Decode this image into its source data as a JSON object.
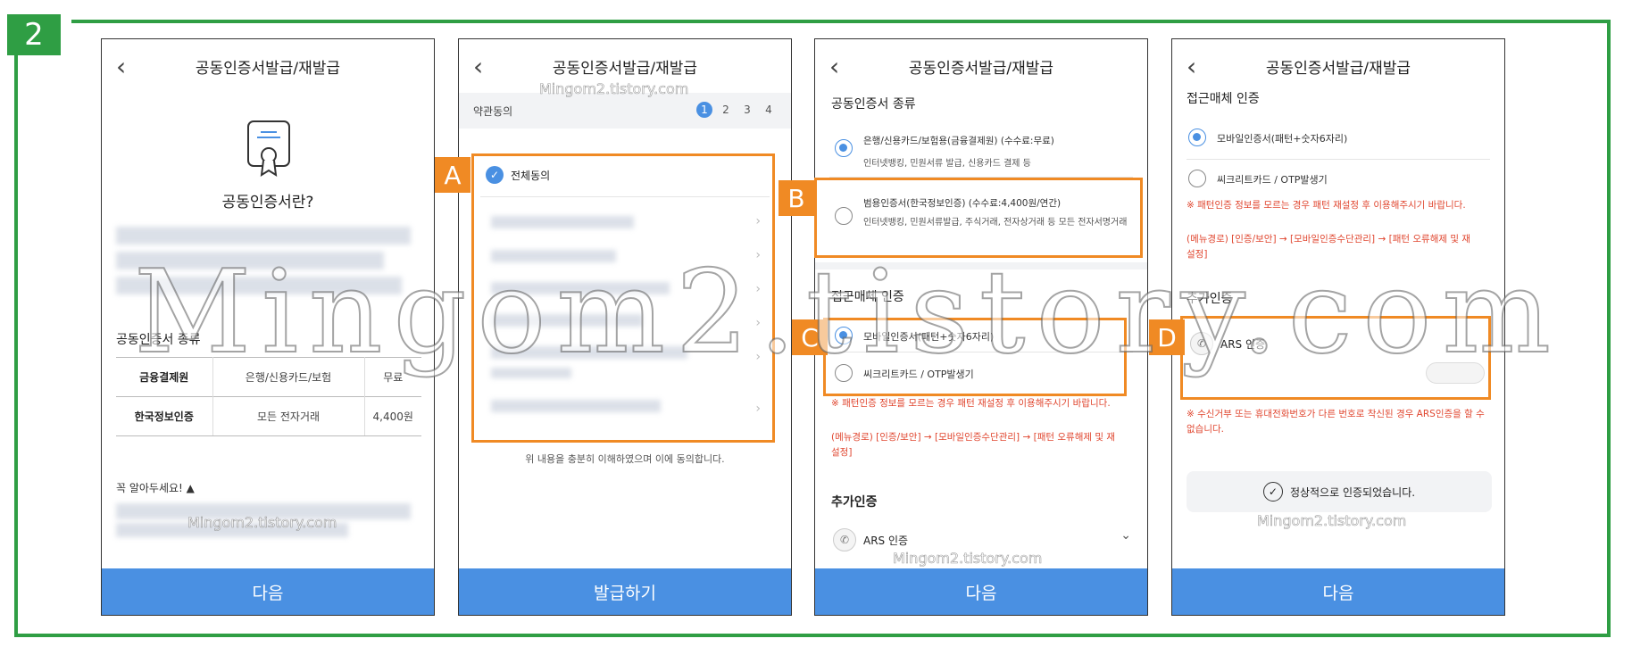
{
  "step_number": "2",
  "app_title": "공동인증서발급/재발급",
  "screen1": {
    "heading": "공동인증서란?",
    "types_title": "공동인증서 종류",
    "table": [
      {
        "name": "금융결제원",
        "scope": "은행/신용카드/보험",
        "fee": "무료"
      },
      {
        "name": "한국정보인증",
        "scope": "모든 전자거래",
        "fee": "4,400원"
      }
    ],
    "notice_label": "꼭 알아두세요! ▲",
    "next_button": "다음"
  },
  "screen2": {
    "section": "약관동의",
    "steps": [
      "1",
      "2",
      "3",
      "4"
    ],
    "agree_all": "전체동의",
    "footnote": "위 내용을 충분히 이해하였으며 이에 동의합니다.",
    "issue_button": "발급하기",
    "tag": "A"
  },
  "screen3": {
    "cert_type_title": "공동인증서 종류",
    "opt1_title": "은행/신용카드/보험용(금융결제원) (수수료:무료)",
    "opt1_desc": "인터넷뱅킹, 민원서류 발급, 신용카드 결제 등",
    "opt2_title": "범용인증서(한국정보인증) (수수료:4,400원/연간)",
    "opt2_desc": "인터넷뱅킹, 민원서류발급, 주식거래, 전자상거래 등 모든 전자서명거래",
    "access_title": "접근매체 인증",
    "mobile_cert": "모바일인증서(패턴+숫자6자리)",
    "secret_card": "씨크리트카드 / OTP발생기",
    "warn1": "※ 패턴인증 정보를 모르는 경우 패턴 재설정 후 이용해주시기 바랍니다.",
    "warn2": "(메뉴경로) [인증/보안] → [모바일인증수단관리] → [패턴 오류해제 및 재설정]",
    "extra_title": "추가인증",
    "ars": "ARS 인증",
    "next_button": "다음",
    "tag_b": "B",
    "tag_c": "C"
  },
  "screen4": {
    "access_title": "접근매체 인증",
    "mobile_cert": "모바일인증서(패턴+숫자6자리)",
    "secret_card": "씨크리트카드 / OTP발생기",
    "warn1": "※ 패턴인증 정보를 모르는 경우 패턴 재설정 후 이용해주시기 바랍니다.",
    "warn2": "(메뉴경로) [인증/보안] → [모바일인증수단관리] → [패턴 오류해제 및 재설정]",
    "extra_title": "추가인증",
    "ars": "ARS 인증",
    "ars_warn": "※ 수신거부 또는 휴대전화번호가 다른 번호로 착신된 경우 ARS인증을 할 수 없습니다.",
    "success": "정상적으로 인증되었습니다.",
    "next_button": "다음",
    "tag": "D"
  },
  "watermark": {
    "big": "Mingom2.tistory.com",
    "small": "Mingom2.tistory.com"
  },
  "colors": {
    "green": "#2f9e44",
    "orange": "#f08a24",
    "blue_button": "#4a90e2",
    "warning_red": "#e0462f"
  }
}
